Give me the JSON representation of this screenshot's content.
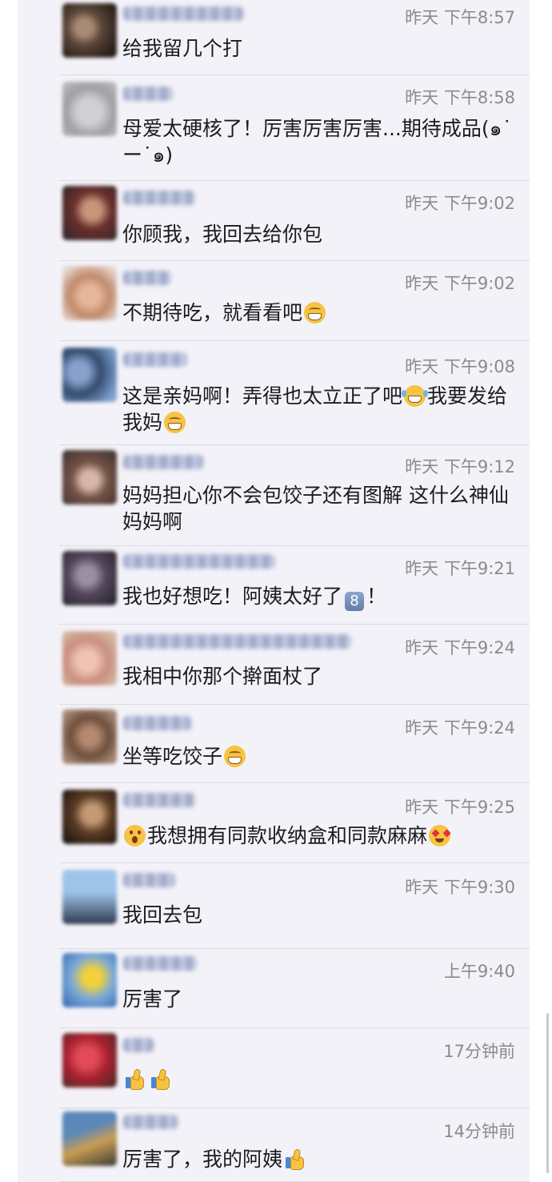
{
  "comments": [
    {
      "time": "昨天 下午8:57",
      "segments": [
        {
          "t": "text",
          "v": "给我留几个打"
        }
      ]
    },
    {
      "time": "昨天 下午8:58",
      "segments": [
        {
          "t": "text",
          "v": "母爱太硬核了！厉害厉害厉害...期待成品(๑˙ー˙๑)"
        }
      ]
    },
    {
      "time": "昨天 下午9:02",
      "segments": [
        {
          "t": "text",
          "v": "你顾我，我回去给你包"
        }
      ]
    },
    {
      "time": "昨天 下午9:02",
      "segments": [
        {
          "t": "text",
          "v": "不期待吃，就看看吧"
        },
        {
          "t": "emoji",
          "v": "grin-icon"
        }
      ]
    },
    {
      "time": "昨天 下午9:08",
      "segments": [
        {
          "t": "text",
          "v": "这是亲妈啊！弄得也太立正了吧"
        },
        {
          "t": "emoji",
          "v": "tears-of-joy-icon"
        },
        {
          "t": "text",
          "v": "我要发给我妈"
        },
        {
          "t": "emoji",
          "v": "grin-icon"
        }
      ]
    },
    {
      "time": "昨天 下午9:12",
      "segments": [
        {
          "t": "text",
          "v": "妈妈担心你不会包饺子还有图解 这什么神仙妈妈啊"
        }
      ]
    },
    {
      "time": "昨天 下午9:21",
      "segments": [
        {
          "t": "text",
          "v": "我也好想吃！阿姨太好了"
        },
        {
          "t": "keycap",
          "v": "8"
        },
        {
          "t": "text",
          "v": "！"
        }
      ]
    },
    {
      "time": "昨天 下午9:24",
      "segments": [
        {
          "t": "text",
          "v": "我相中你那个擀面杖了"
        }
      ]
    },
    {
      "time": "昨天 下午9:24",
      "segments": [
        {
          "t": "text",
          "v": "坐等吃饺子"
        },
        {
          "t": "emoji",
          "v": "grin-icon"
        }
      ]
    },
    {
      "time": "昨天 下午9:25",
      "segments": [
        {
          "t": "emoji",
          "v": "surprised-face-icon"
        },
        {
          "t": "text",
          "v": "我想拥有同款收纳盒和同款麻麻"
        },
        {
          "t": "emoji",
          "v": "heart-eyes-icon"
        }
      ]
    },
    {
      "time": "昨天 下午9:30",
      "segments": [
        {
          "t": "text",
          "v": "我回去包"
        }
      ]
    },
    {
      "time": "上午9:40",
      "segments": [
        {
          "t": "text",
          "v": "厉害了"
        }
      ]
    },
    {
      "time": "17分钟前",
      "segments": [
        {
          "t": "emoji",
          "v": "thumbs-up-icon"
        },
        {
          "t": "emoji",
          "v": "thumbs-up-icon"
        }
      ]
    },
    {
      "time": "14分钟前",
      "segments": [
        {
          "t": "text",
          "v": "厉害了，我的阿姨"
        },
        {
          "t": "emoji",
          "v": "thumbs-up-icon"
        }
      ]
    }
  ],
  "colors": {
    "panel_bg": "#f3f2f8",
    "text": "#1c1c1e",
    "time": "#8a8a8f",
    "divider": "#dcdbe2"
  }
}
